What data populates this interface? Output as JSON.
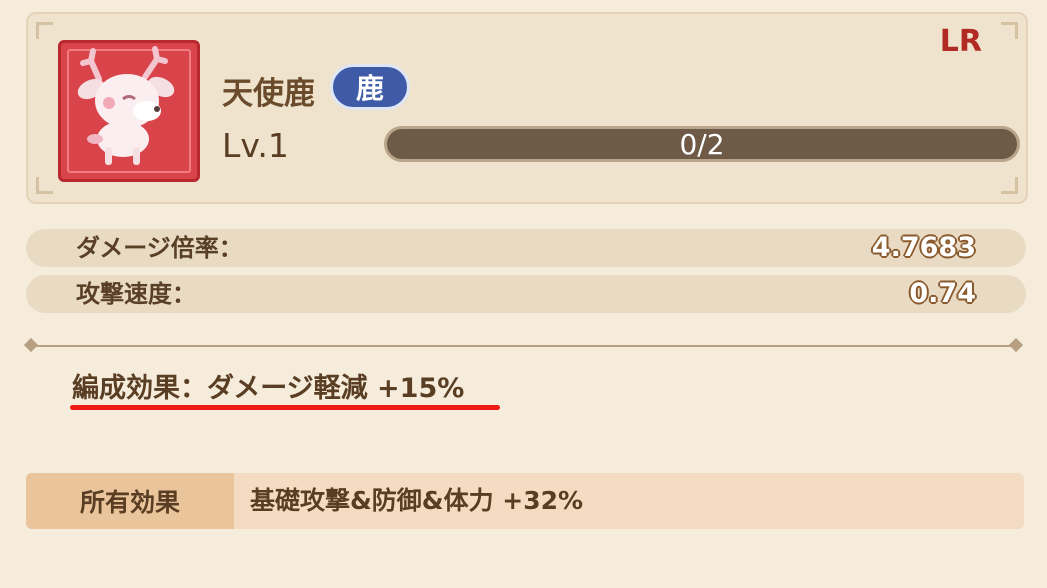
{
  "character": {
    "name": "天使鹿",
    "type_badge": "鹿",
    "rarity": "LR",
    "level": "Lv.1",
    "progress_text": "0/2",
    "progress_fraction": 0
  },
  "stats": [
    {
      "label": "ダメージ倍率：",
      "value": "4.7683"
    },
    {
      "label": "攻撃速度：",
      "value": "0.74"
    }
  ],
  "formation_effect": "編成効果：ダメージ軽減 +15%",
  "owned_effect": {
    "label": "所有効果",
    "value": "基礎攻撃&防御&体力 +32%"
  },
  "colors": {
    "rarity": "#b12a24",
    "type_badge": "#3f5aa7",
    "portrait_frame": "#d9444a",
    "highlight_underline": "#ee1b16"
  }
}
